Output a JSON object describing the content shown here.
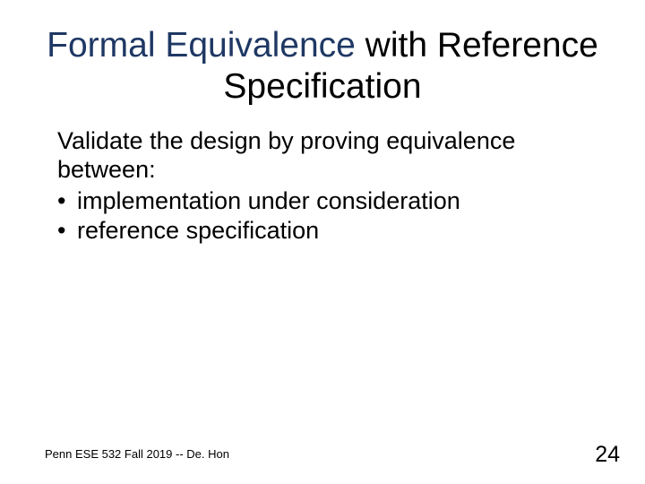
{
  "title": {
    "part1": "Formal Equivalence",
    "part2": " with Reference Specification"
  },
  "body": {
    "lead": "Validate the design by proving equivalence between:",
    "bullets": [
      "implementation under consideration",
      "reference specification"
    ]
  },
  "footer": {
    "left": "Penn ESE 532 Fall 2019 -- De. Hon",
    "page": "24"
  }
}
